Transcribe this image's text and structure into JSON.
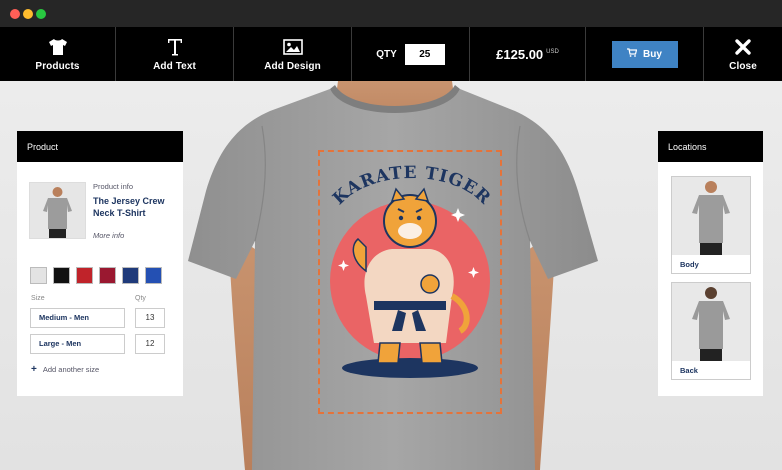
{
  "toolbar": {
    "products_label": "Products",
    "add_text_label": "Add Text",
    "add_design_label": "Add Design",
    "qty_label": "QTY",
    "qty_value": "25",
    "price": "£125.00",
    "currency": "USD",
    "buy_label": "Buy",
    "close_label": "Close"
  },
  "design": {
    "title_text": "KARATE TIGER",
    "colors": {
      "circle": "#ea6465",
      "navy": "#1d3560",
      "print_border": "#e5733a"
    }
  },
  "product_panel": {
    "header": "Product",
    "info_label": "Product info",
    "product_name": "The Jersey Crew Neck T-Shirt",
    "more_info": "More info",
    "swatches": [
      "#e3e3e3",
      "#111111",
      "#c0232a",
      "#9a1830",
      "#1f3a7a",
      "#2450b3"
    ],
    "size_header": "Size",
    "qty_header": "Qty",
    "sizes": [
      {
        "size": "Medium - Men",
        "qty": "13"
      },
      {
        "size": "Large - Men",
        "qty": "12"
      }
    ],
    "add_size": "Add another size"
  },
  "locations_panel": {
    "header": "Locations",
    "locations": [
      {
        "label": "Body"
      },
      {
        "label": "Back"
      }
    ]
  },
  "accent_color": "#3f83c4"
}
